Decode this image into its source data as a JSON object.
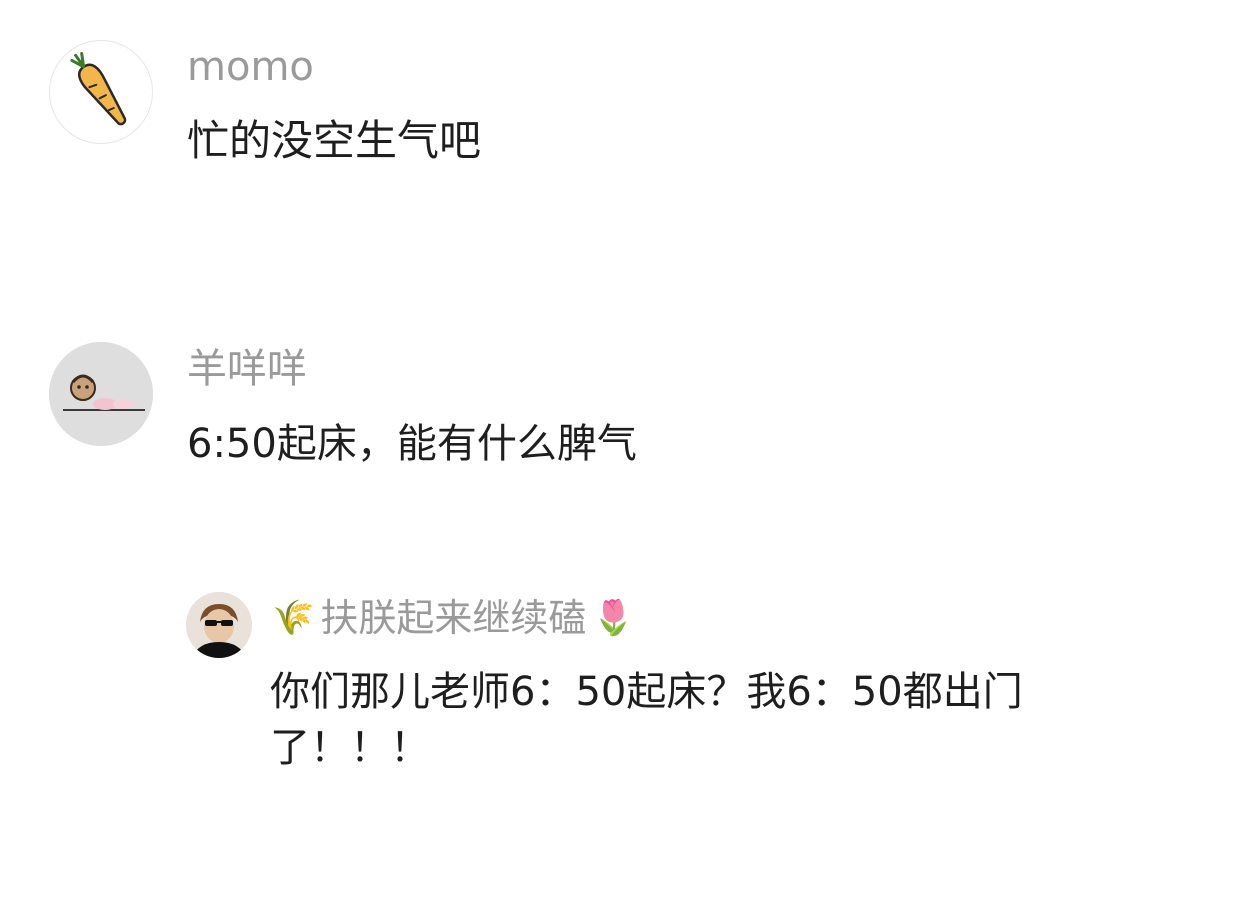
{
  "comments": [
    {
      "username": "momo",
      "text": "忙的没空生气吧",
      "avatar_icon": "carrot-icon"
    },
    {
      "username": "羊咩咩",
      "text": "6:50起床，能有什么脾气",
      "avatar_icon": "doll-photo-icon"
    }
  ],
  "reply": {
    "username_prefix_emoji": "🌾",
    "username": "扶朕起来继续磕",
    "username_suffix_emoji": "🌷",
    "text": "你们那儿老师6：50起床？我6：50都出门了！！！",
    "avatar_icon": "person-sunglasses-icon"
  }
}
